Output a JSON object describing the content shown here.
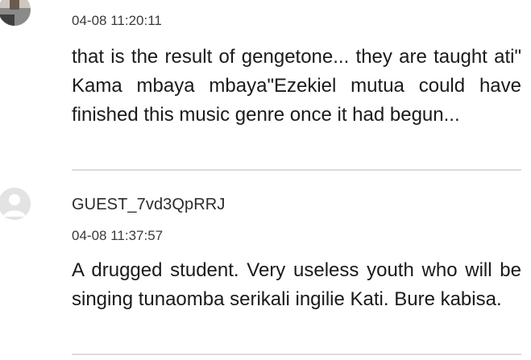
{
  "comments": [
    {
      "avatar": "photo-avatar-icon",
      "username": "",
      "timestamp": "04-08 11:20:11",
      "text": "that is the result of gengetone... they are taught ati\" Kama mbaya mbaya\"Ezekiel mutua could have finished this music genre once it had begun..."
    },
    {
      "avatar": "default-user-avatar-icon",
      "username": "GUEST_7vd3QpRRJ",
      "timestamp": "04-08 11:37:57",
      "text": "A drugged student. Very useless youth who will be singing tunaomba serikali ingilie Kati. Bure kabisa."
    }
  ],
  "colors": {
    "divider": "#dcdcdc",
    "text": "#1a1a1a",
    "meta": "#3a3a3a"
  }
}
